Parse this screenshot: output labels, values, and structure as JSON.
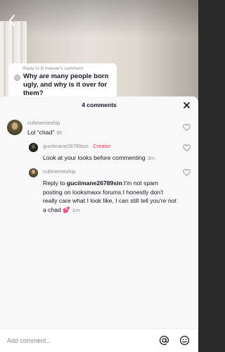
{
  "reply_card": {
    "reply_to": "Reply to lil.maxxer's comment",
    "question": "Why are many people born ugly, and why is it over for them?"
  },
  "sheet": {
    "comments_count": "4 comments"
  },
  "comments": [
    {
      "username": "cultmemeship",
      "text": "Lol “chad”",
      "time": "9h"
    },
    {
      "username": "guciimane26789sin",
      "separator": "·",
      "badge": "Creator",
      "text": "Look at your looks before commenting",
      "time": "3m"
    },
    {
      "username": "cultmemeship",
      "reply_prefix": "Reply to",
      "reply_target": "guciimane26789sin",
      "text": ":I'm not spam posting on looksmaxx forums I honestly don't really care what I look like, I can still tell you're not a chad",
      "emoji": "💕",
      "time": "1m"
    }
  ],
  "composer": {
    "placeholder": "Add comment..."
  },
  "colors": {
    "accent_creator": "#fe2c55",
    "text_primary": "#161823",
    "text_secondary": "#8a8b91"
  },
  "icons": {
    "back": "chevron-left-icon",
    "close": "close-icon",
    "like": "heart-outline-icon",
    "mention": "at-sign-icon",
    "emoji": "smiley-icon"
  }
}
